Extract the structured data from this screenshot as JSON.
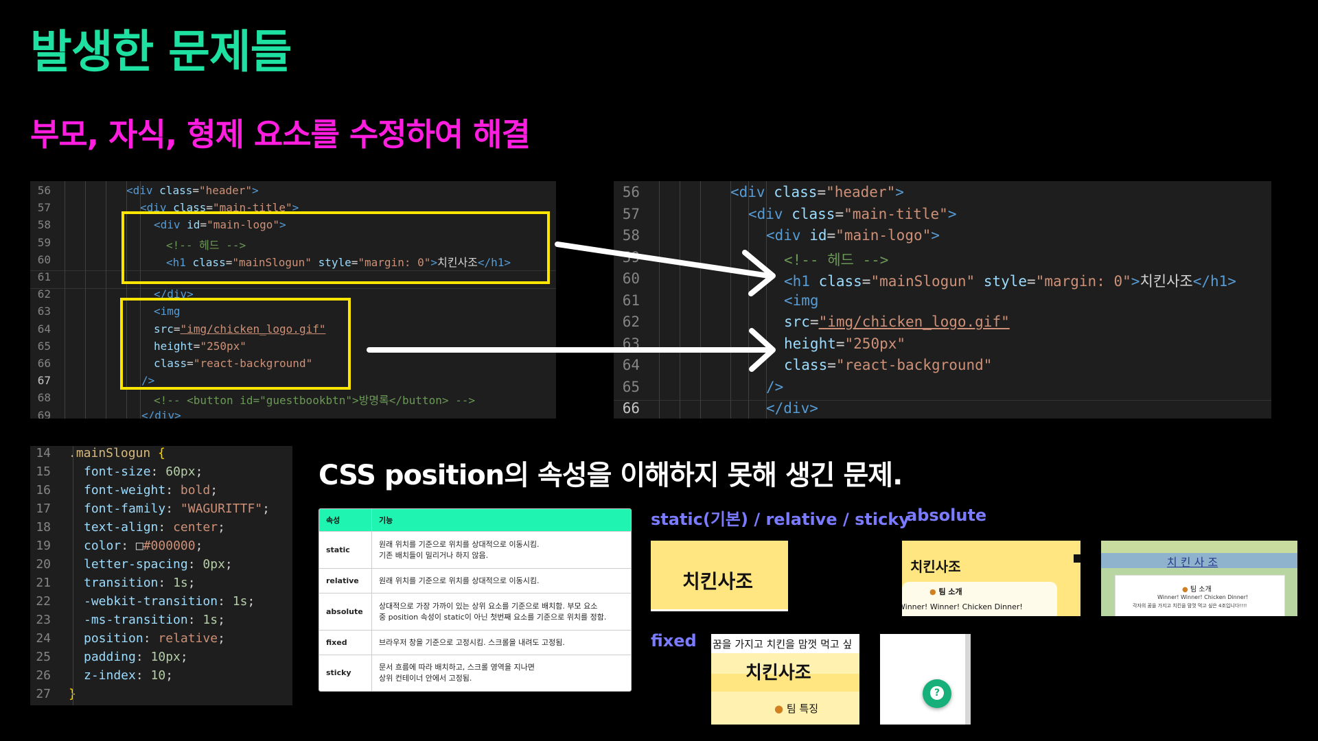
{
  "title": "발생한 문제들",
  "subtitle": "부모, 자식, 형제 요소를 수정하여 해결",
  "section_title": "CSS position의 속성을 이해하지 못해 생긴 문제.",
  "before_code": {
    "line_numbers": [
      "56",
      "57",
      "58",
      "59",
      "60",
      "61",
      "62",
      "63",
      "64",
      "65",
      "66",
      "67",
      "68",
      "69"
    ],
    "lines": [
      {
        "parts": [
          [
            "tag",
            "<div "
          ],
          [
            "att",
            "class"
          ],
          [
            "txt",
            "="
          ],
          [
            "str",
            "\"header\""
          ],
          [
            "tag",
            ">"
          ]
        ]
      },
      {
        "parts": [
          [
            "tag",
            "<div "
          ],
          [
            "att",
            "class"
          ],
          [
            "txt",
            "="
          ],
          [
            "str",
            "\"main-title\""
          ],
          [
            "tag",
            ">"
          ]
        ]
      },
      {
        "parts": [
          [
            "tag",
            "<div "
          ],
          [
            "att",
            "id"
          ],
          [
            "txt",
            "="
          ],
          [
            "str",
            "\"main-logo\""
          ],
          [
            "tag",
            ">"
          ]
        ]
      },
      {
        "parts": [
          [
            "cm",
            "<!-- 헤드 -->"
          ]
        ]
      },
      {
        "parts": [
          [
            "tag",
            "<h1 "
          ],
          [
            "att",
            "class"
          ],
          [
            "txt",
            "="
          ],
          [
            "str",
            "\"mainSlogun\" "
          ],
          [
            "att",
            "style"
          ],
          [
            "txt",
            "="
          ],
          [
            "str",
            "\"margin: 0\""
          ],
          [
            "tag",
            ">"
          ],
          [
            "txt",
            "치킨사조"
          ],
          [
            "tag",
            "</h1>"
          ]
        ]
      },
      {
        "parts": []
      },
      {
        "parts": [
          [
            "tag",
            "</div>"
          ]
        ]
      },
      {
        "parts": [
          [
            "tag",
            "<img"
          ]
        ]
      },
      {
        "parts": [
          [
            "att",
            "src"
          ],
          [
            "txt",
            "="
          ],
          [
            "str",
            "\"img/chicken_logo.gif\""
          ]
        ]
      },
      {
        "parts": [
          [
            "att",
            "height"
          ],
          [
            "txt",
            "="
          ],
          [
            "str",
            "\"250px\""
          ]
        ]
      },
      {
        "parts": [
          [
            "att",
            "class"
          ],
          [
            "txt",
            "="
          ],
          [
            "str",
            "\"react-background\""
          ]
        ]
      },
      {
        "parts": [
          [
            "tag",
            "/>"
          ]
        ]
      },
      {
        "parts": [
          [
            "cm",
            "<!-- <button id=\"guestbookbtn\">방명록</button> -->"
          ]
        ]
      },
      {
        "parts": [
          [
            "tag",
            "</div>"
          ]
        ]
      }
    ]
  },
  "after_code": {
    "line_numbers": [
      "56",
      "57",
      "58",
      "59",
      "60",
      "61",
      "62",
      "63",
      "64",
      "65",
      "66"
    ],
    "lines": [
      {
        "parts": [
          [
            "tag",
            "<div "
          ],
          [
            "att",
            "class"
          ],
          [
            "txt",
            "="
          ],
          [
            "str",
            "\"header\""
          ],
          [
            "tag",
            ">"
          ]
        ]
      },
      {
        "parts": [
          [
            "tag",
            "<div "
          ],
          [
            "att",
            "class"
          ],
          [
            "txt",
            "="
          ],
          [
            "str",
            "\"main-title\""
          ],
          [
            "tag",
            ">"
          ]
        ]
      },
      {
        "parts": [
          [
            "tag",
            "<div "
          ],
          [
            "att",
            "id"
          ],
          [
            "txt",
            "="
          ],
          [
            "str",
            "\"main-logo\""
          ],
          [
            "tag",
            ">"
          ]
        ]
      },
      {
        "parts": [
          [
            "cm",
            "<!-- 헤드 -->"
          ]
        ]
      },
      {
        "parts": [
          [
            "tag",
            "<h1 "
          ],
          [
            "att",
            "class"
          ],
          [
            "txt",
            "="
          ],
          [
            "str",
            "\"mainSlogun\" "
          ],
          [
            "att",
            "style"
          ],
          [
            "txt",
            "="
          ],
          [
            "str",
            "\"margin: 0\""
          ],
          [
            "tag",
            ">"
          ],
          [
            "txt",
            "치킨사조"
          ],
          [
            "tag",
            "</h1>"
          ]
        ]
      },
      {
        "parts": [
          [
            "tag",
            "<img"
          ]
        ]
      },
      {
        "parts": [
          [
            "att",
            "src"
          ],
          [
            "txt",
            "="
          ],
          [
            "str",
            "\"img/chicken_logo.gif\""
          ]
        ]
      },
      {
        "parts": [
          [
            "att",
            "height"
          ],
          [
            "txt",
            "="
          ],
          [
            "str",
            "\"250px\""
          ]
        ]
      },
      {
        "parts": [
          [
            "att",
            "class"
          ],
          [
            "txt",
            "="
          ],
          [
            "str",
            "\"react-background\""
          ]
        ]
      },
      {
        "parts": [
          [
            "tag",
            "/>"
          ]
        ]
      },
      {
        "parts": [
          [
            "tag",
            "</div>"
          ]
        ]
      }
    ]
  },
  "css_code": {
    "line_numbers": [
      "14",
      "15",
      "16",
      "17",
      "18",
      "19",
      "20",
      "21",
      "22",
      "23",
      "24",
      "25",
      "26",
      "27"
    ],
    "lines": [
      {
        "parts": [
          [
            "sel",
            ".mainSlogun "
          ],
          [
            "brace",
            "{"
          ]
        ]
      },
      {
        "parts": [
          [
            "prop",
            "font-size"
          ],
          [
            "txt",
            ": "
          ],
          [
            "num",
            "60px"
          ],
          [
            "txt",
            ";"
          ]
        ]
      },
      {
        "parts": [
          [
            "prop",
            "font-weight"
          ],
          [
            "txt",
            ": "
          ],
          [
            "val",
            "bold"
          ],
          [
            "txt",
            ";"
          ]
        ]
      },
      {
        "parts": [
          [
            "prop",
            "font-family"
          ],
          [
            "txt",
            ": "
          ],
          [
            "val",
            "\"WAGURITTF\""
          ],
          [
            "txt",
            ";"
          ]
        ]
      },
      {
        "parts": [
          [
            "prop",
            "text-align"
          ],
          [
            "txt",
            ": "
          ],
          [
            "val",
            "center"
          ],
          [
            "txt",
            ";"
          ]
        ]
      },
      {
        "parts": [
          [
            "prop",
            "color"
          ],
          [
            "txt",
            ": "
          ],
          [
            "txt",
            "□"
          ],
          [
            "val",
            "#000000"
          ],
          [
            "txt",
            ";"
          ]
        ]
      },
      {
        "parts": [
          [
            "prop",
            "letter-spacing"
          ],
          [
            "txt",
            ": "
          ],
          [
            "num",
            "0px"
          ],
          [
            "txt",
            ";"
          ]
        ]
      },
      {
        "parts": [
          [
            "prop",
            "transition"
          ],
          [
            "txt",
            ": "
          ],
          [
            "num",
            "1s"
          ],
          [
            "txt",
            ";"
          ]
        ]
      },
      {
        "parts": [
          [
            "prop",
            "-webkit-transition"
          ],
          [
            "txt",
            ": "
          ],
          [
            "num",
            "1s"
          ],
          [
            "txt",
            ";"
          ]
        ]
      },
      {
        "parts": [
          [
            "prop",
            "-ms-transition"
          ],
          [
            "txt",
            ": "
          ],
          [
            "num",
            "1s"
          ],
          [
            "txt",
            ";"
          ]
        ]
      },
      {
        "parts": [
          [
            "prop",
            "position"
          ],
          [
            "txt",
            ": "
          ],
          [
            "val",
            "relative"
          ],
          [
            "txt",
            ";"
          ]
        ]
      },
      {
        "parts": [
          [
            "prop",
            "padding"
          ],
          [
            "txt",
            ": "
          ],
          [
            "num",
            "10px"
          ],
          [
            "txt",
            ";"
          ]
        ]
      },
      {
        "parts": [
          [
            "prop",
            "z-index"
          ],
          [
            "txt",
            ": "
          ],
          [
            "num",
            "10"
          ],
          [
            "txt",
            ";"
          ]
        ]
      },
      {
        "parts": [
          [
            "brace",
            "}"
          ]
        ]
      }
    ]
  },
  "position_table": {
    "headers": [
      "속성",
      "기능"
    ],
    "rows": [
      {
        "key": "static",
        "desc1": "원래 위치를 기준으로 위치를 상대적으로 이동시킴.",
        "desc2": "기존 배치들이 밀리거나 하지 않음."
      },
      {
        "key": "relative",
        "desc1": "원래 위치를 기준으로 위치를 상대적으로 이동시킴.",
        "desc2": ""
      },
      {
        "key": "absolute",
        "desc1": "상대적으로 가장 가까이 있는 상위 요소를 기준으로 배치함. 부모 요소",
        "desc2": "중 position 속성이 static이 아닌 첫번째 요소를 기준으로 위치를 정함."
      },
      {
        "key": "fixed",
        "desc1": "브라우저 창을 기준으로 고정시킴. 스크롤을 내려도 고정됨.",
        "desc2": ""
      },
      {
        "key": "sticky",
        "desc1": "문서 흐름에 따라 배치하고, 스크롤 영역을 지나면",
        "desc2": "상위 컨테이너 안에서 고정됨."
      }
    ]
  },
  "labels": {
    "static_relative_sticky": "static(기본) / relative / sticky",
    "absolute": "absolute",
    "fixed": "fixed"
  },
  "thumbs": {
    "static_logo": "치킨사조",
    "abs1_logo": "치킨사조",
    "abs1_team": "팀 소개",
    "abs1_slogan": "Winner! Winner! Chicken Dinner!",
    "abs2_logo": "치 킨 사 조",
    "abs2_team": "팀 소개",
    "abs2_slogan": "Winner! Winner! Chicken Dinner!",
    "abs2_desc": "각자의 꿈을 가지고 치킨을 맘껏 먹고 싶은 4조입니다!!!!",
    "fixed_marquee": "꿈을 가지고 치킨을 맘껏 먹고 싶",
    "fixed_logo": "치킨사조",
    "fixed_team": "팀 특징"
  },
  "colors": {
    "title": "#1ee0a0",
    "subtitle": "#ff1ee0",
    "highlight_box": "#ffe600",
    "table_header": "#1ff5b0",
    "label": "#7b7bff",
    "thumb_yellow": "#ffe680",
    "help_button": "#18b07a"
  }
}
